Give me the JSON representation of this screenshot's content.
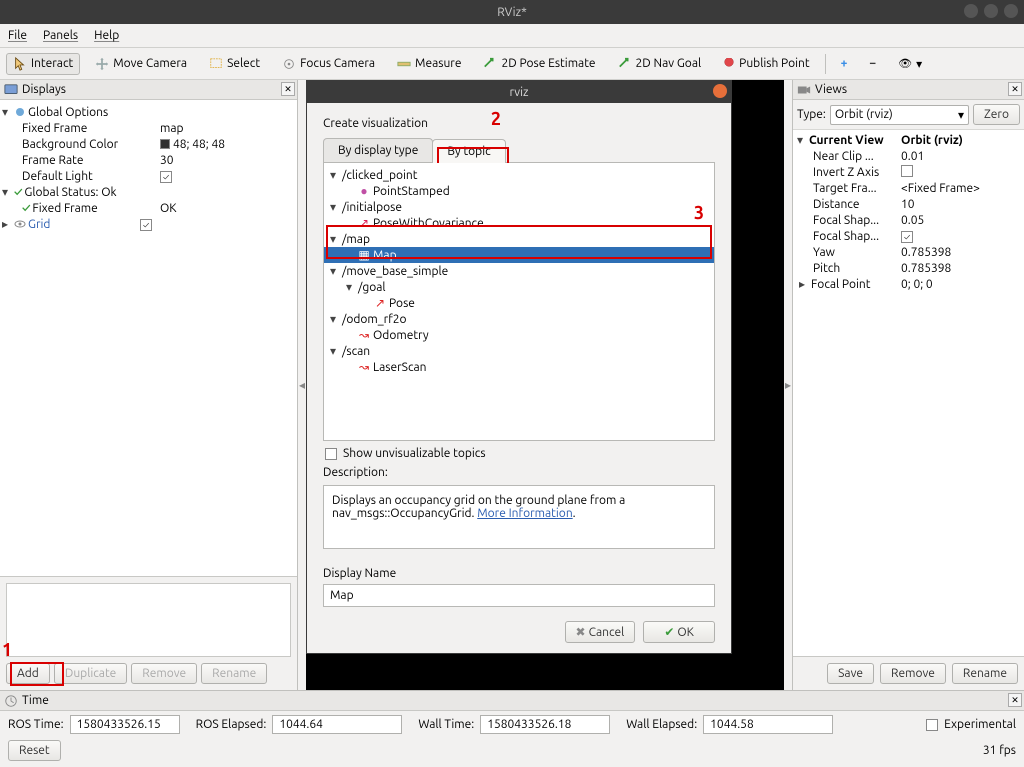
{
  "window_title": "RViz*",
  "menus": {
    "file": "File",
    "panels": "Panels",
    "help": "Help"
  },
  "toolbar": {
    "interact": "Interact",
    "move_camera": "Move Camera",
    "select": "Select",
    "focus_camera": "Focus Camera",
    "measure": "Measure",
    "pose_estimate": "2D Pose Estimate",
    "nav_goal": "2D Nav Goal",
    "publish_point": "Publish Point"
  },
  "displays_panel": {
    "title": "Displays",
    "tree": {
      "global_options": "Global Options",
      "fixed_frame_k": "Fixed Frame",
      "fixed_frame_v": "map",
      "bg_k": "Background Color",
      "bg_v": "48; 48; 48",
      "rate_k": "Frame Rate",
      "rate_v": "30",
      "defl_k": "Default Light",
      "status_k": "Global Status: Ok",
      "ff_status_k": "Fixed Frame",
      "ff_status_v": "OK",
      "grid_k": "Grid"
    },
    "buttons": {
      "add": "Add",
      "duplicate": "Duplicate",
      "remove": "Remove",
      "rename": "Rename"
    }
  },
  "dialog": {
    "title": "rviz",
    "heading": "Create visualization",
    "tab_display": "By display type",
    "tab_topic": "By topic",
    "topics": {
      "clicked_point": "/clicked_point",
      "point_stamped": "PointStamped",
      "initialpose": "/initialpose",
      "pose_cov": "PoseWithCovariance",
      "map": "/map",
      "map_type": "Map",
      "mbs": "/move_base_simple",
      "goal": "/goal",
      "pose": "Pose",
      "odom_rf2o": "/odom_rf2o",
      "odometry": "Odometry",
      "scan": "/scan",
      "laserscan": "LaserScan"
    },
    "show_unvis": "Show unvisualizable topics",
    "desc_label": "Description:",
    "desc_text1": "Displays an occupancy grid on the ground plane from a nav_msgs::OccupancyGrid. ",
    "desc_link": "More Information",
    "name_label": "Display Name",
    "name_value": "Map",
    "cancel": "Cancel",
    "ok": "OK"
  },
  "views_panel": {
    "title": "Views",
    "type_label": "Type:",
    "type_value": "Orbit (rviz)",
    "zero": "Zero",
    "rows": {
      "current_view_k": "Current View",
      "current_view_v": "Orbit (rviz)",
      "near_k": "Near Clip ...",
      "near_v": "0.01",
      "invz_k": "Invert Z Axis",
      "tgt_k": "Target Fra...",
      "tgt_v": "<Fixed Frame>",
      "dist_k": "Distance",
      "dist_v": "10",
      "fs1_k": "Focal Shap...",
      "fs1_v": "0.05",
      "fs2_k": "Focal Shap...",
      "yaw_k": "Yaw",
      "yaw_v": "0.785398",
      "pitch_k": "Pitch",
      "pitch_v": "0.785398",
      "fp_k": "Focal Point",
      "fp_v": "0; 0; 0"
    },
    "buttons": {
      "save": "Save",
      "remove": "Remove",
      "rename": "Rename"
    }
  },
  "time_panel": {
    "title": "Time",
    "ros_time_l": "ROS Time:",
    "ros_time_v": "1580433526.15",
    "ros_el_l": "ROS Elapsed:",
    "ros_el_v": "1044.64",
    "wall_time_l": "Wall Time:",
    "wall_time_v": "1580433526.18",
    "wall_el_l": "Wall Elapsed:",
    "wall_el_v": "1044.58",
    "experimental": "Experimental",
    "reset": "Reset",
    "fps": "31 fps"
  },
  "annotations": {
    "label1": "1",
    "label2": "2",
    "label3": "3"
  }
}
